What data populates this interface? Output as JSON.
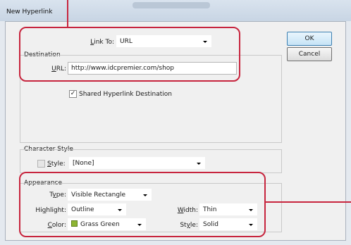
{
  "window": {
    "title": "New Hyperlink"
  },
  "buttons": {
    "ok": "OK",
    "cancel": "Cancel"
  },
  "link": {
    "label_pre": "",
    "label_u": "L",
    "label_post": "ink To:",
    "value": "URL"
  },
  "destination": {
    "header": "Destination",
    "url_label_u": "U",
    "url_label_post": "RL:",
    "url_value": "http://www.idcpremier.com/shop",
    "shared_label": "Shared Hyperlink Destination",
    "shared_checked": true
  },
  "character_style": {
    "header": "Character Style",
    "style_label_u": "S",
    "style_label_post": "tyle:",
    "style_value": "[None]"
  },
  "appearance": {
    "header": "Appearance",
    "type_label_pre": "T",
    "type_label_u": "y",
    "type_label_post": "pe:",
    "type_value": "Visible Rectangle",
    "highlight_label_pre": "Hi",
    "highlight_label_u": "g",
    "highlight_label_post": "hlight:",
    "highlight_value": "Outline",
    "width_label_u": "W",
    "width_label_post": "idth:",
    "width_value": "Thin",
    "color_label_u": "C",
    "color_label_post": "olor:",
    "color_value": "Grass Green",
    "color_swatch": "#8db532",
    "style_label_pre": "St",
    "style_label_u": "y",
    "style_label_post": "le:",
    "style_value": "Solid"
  },
  "colors": {
    "callout": "#c7253e"
  }
}
